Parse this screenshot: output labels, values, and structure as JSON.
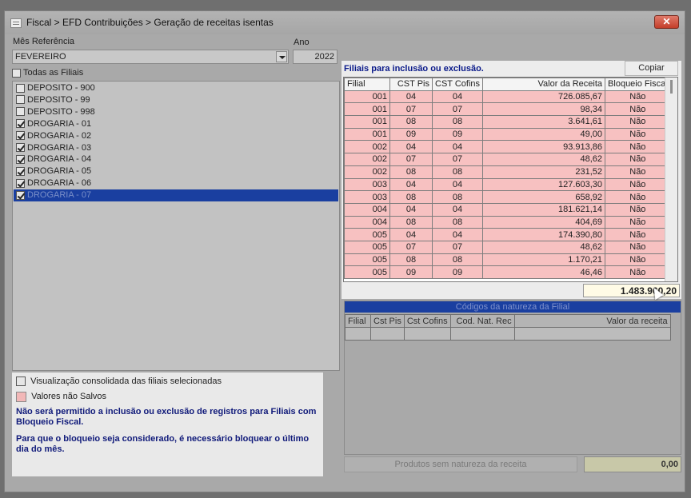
{
  "window": {
    "title": "Fiscal > EFD Contribuições > Geração de receitas isentas",
    "close_label": "✕"
  },
  "reference": {
    "month_label": "Mês Referência",
    "month_value": "FEVEREIRO",
    "year_label": "Ano",
    "year_value": "2022"
  },
  "branches": {
    "all_label": "Todas as Filiais",
    "all_checked": false,
    "items": [
      {
        "label": "DEPOSITO - 900",
        "checked": false,
        "selected": false
      },
      {
        "label": "DEPOSITO - 99",
        "checked": false,
        "selected": false
      },
      {
        "label": "DEPOSITO - 998",
        "checked": false,
        "selected": false
      },
      {
        "label": "DROGARIA - 01",
        "checked": true,
        "selected": false
      },
      {
        "label": "DROGARIA - 02",
        "checked": true,
        "selected": false
      },
      {
        "label": "DROGARIA - 03",
        "checked": true,
        "selected": false
      },
      {
        "label": "DROGARIA - 04",
        "checked": true,
        "selected": false
      },
      {
        "label": "DROGARIA - 05",
        "checked": true,
        "selected": false
      },
      {
        "label": "DROGARIA - 06",
        "checked": true,
        "selected": false
      },
      {
        "label": "DROGARIA - 07",
        "checked": true,
        "selected": true
      }
    ]
  },
  "options": {
    "consolidated_label": "Visualização consolidada das filiais selecionadas",
    "unsaved_label": "Valores não Salvos",
    "note1": "Não será permitido a inclusão ou exclusão de registros para Filiais com Bloqueio Fiscal.",
    "note2": "Para que o bloqueio seja considerado, é necessário bloquear o último dia do mês."
  },
  "inclusion": {
    "title": "Filiais para inclusão ou exclusão.",
    "copy_label": "Copiar",
    "columns": [
      "Filial",
      "CST Pis",
      "CST Cofins",
      "Valor da Receita",
      "Bloqueio Fiscal"
    ],
    "rows": [
      [
        "001",
        "04",
        "04",
        "726.085,67",
        "Não"
      ],
      [
        "001",
        "07",
        "07",
        "98,34",
        "Não"
      ],
      [
        "001",
        "08",
        "08",
        "3.641,61",
        "Não"
      ],
      [
        "001",
        "09",
        "09",
        "49,00",
        "Não"
      ],
      [
        "002",
        "04",
        "04",
        "93.913,86",
        "Não"
      ],
      [
        "002",
        "07",
        "07",
        "48,62",
        "Não"
      ],
      [
        "002",
        "08",
        "08",
        "231,52",
        "Não"
      ],
      [
        "003",
        "04",
        "04",
        "127.603,30",
        "Não"
      ],
      [
        "003",
        "08",
        "08",
        "658,92",
        "Não"
      ],
      [
        "004",
        "04",
        "04",
        "181.621,14",
        "Não"
      ],
      [
        "004",
        "08",
        "08",
        "404,69",
        "Não"
      ],
      [
        "005",
        "04",
        "04",
        "174.390,80",
        "Não"
      ],
      [
        "005",
        "07",
        "07",
        "48,62",
        "Não"
      ],
      [
        "005",
        "08",
        "08",
        "1.170,21",
        "Não"
      ],
      [
        "005",
        "09",
        "09",
        "46,46",
        "Não"
      ]
    ],
    "total": "1.483.960,20"
  },
  "nature": {
    "header": "Códigos da natureza  da Filial",
    "columns": [
      "Filial",
      "Cst Pis",
      "Cst Cofins",
      "Cod.  Nat. Rec",
      "Valor da receita"
    ],
    "products_button": "Produtos sem natureza  da receita",
    "products_total": "0,00"
  }
}
